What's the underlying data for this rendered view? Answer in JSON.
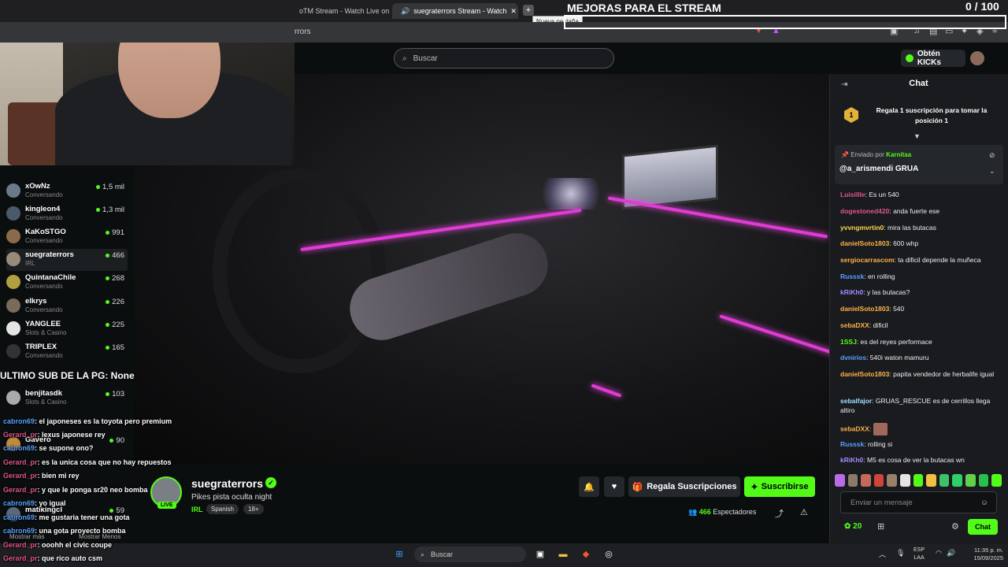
{
  "browser": {
    "tabs": [
      {
        "label": "oTM Stream - Watch Live on Ki"
      },
      {
        "label": "suegraterrors Stream - Watch"
      }
    ],
    "tooltip": "Nueva pestaña",
    "address": "rrors"
  },
  "overlay": {
    "title": "MEJORAS PARA EL STREAM",
    "counter": "0 / 100",
    "ultimo_sub": "ULTIMO SUB DE LA PG: None"
  },
  "header": {
    "search_placeholder": "Buscar",
    "kicks_label": "Obtén KICKs"
  },
  "sidebar": {
    "channels": [
      {
        "name": "xOwNz",
        "category": "Conversando",
        "viewers": "1,5 mil"
      },
      {
        "name": "kingleon4",
        "category": "Conversando",
        "viewers": "1,3 mil"
      },
      {
        "name": "KaKoSTGO",
        "category": "Conversando",
        "viewers": "991"
      },
      {
        "name": "suegraterrors",
        "category": "IRL",
        "viewers": "466"
      },
      {
        "name": "QuintanaChile",
        "category": "Conversando",
        "viewers": "268"
      },
      {
        "name": "elkrys",
        "category": "Conversando",
        "viewers": "226"
      },
      {
        "name": "YANGLEE",
        "category": "Slots & Casino",
        "viewers": "225"
      },
      {
        "name": "TRIPLEX",
        "category": "Conversando",
        "viewers": "165"
      },
      {
        "name": "benjitasdk",
        "category": "Slots & Casino",
        "viewers": "103"
      },
      {
        "name": "Gavero",
        "category": "",
        "viewers": "90"
      },
      {
        "name": "matikingcl",
        "category": "",
        "viewers": "59"
      }
    ],
    "show_more": "Mostrar más",
    "show_less": "Mostrar Menos"
  },
  "overlay_chat": [
    {
      "user": "cabron69",
      "text": "el japoneses es la toyota pero premium"
    },
    {
      "user": "Gerard_pr",
      "text": "lexus japonese rey"
    },
    {
      "user": "cabron69",
      "text": "se supone ono?"
    },
    {
      "user": "Gerard_pr",
      "text": "es la unica cosa que no hay repuestos"
    },
    {
      "user": "Gerard_pr",
      "text": "bien mi rey"
    },
    {
      "user": "Gerard_pr",
      "text": "y que le ponga sr20 neo bomba"
    },
    {
      "user": "cabron69",
      "text": "yo igual"
    },
    {
      "user": "cabron69",
      "text": "me gustaria tener una gota"
    },
    {
      "user": "cabron69",
      "text": "una gota proyecto bomba"
    },
    {
      "user": "Gerard_pr",
      "text": "ooohh el civic coupe"
    },
    {
      "user": "Gerard_pr",
      "text": "que rico auto csm"
    }
  ],
  "stream": {
    "streamer": "suegraterrors",
    "live_badge": "LIVE",
    "title": "Pikes pista oculta night",
    "category": "IRL",
    "tags": [
      "Spanish",
      "18+"
    ],
    "gift_label": "Regala Suscripciones",
    "subscribe_label": "Suscribirse",
    "viewers_count": "466",
    "viewers_label": "Espectadores"
  },
  "chat": {
    "title": "Chat",
    "gift_banner": "Regala 1 suscripción para tomar la posición 1",
    "gift_rank": "1",
    "pinned_by_label": "Enviado por",
    "pinned_by_user": "Karnitaa",
    "pinned_message": "@a_arismendi GRUA",
    "messages": [
      {
        "user": "Luisillle",
        "text": ": Es un 540",
        "color": "#e0568a"
      },
      {
        "user": "dogestoned420",
        "text": ": anda fuerte ese",
        "color": "#e0568a"
      },
      {
        "user": "yvvngmvrtin0",
        "text": ": mira las butacas",
        "color": "#ffd84d"
      },
      {
        "user": "danielSoto1803",
        "text": ": 600 whp",
        "color": "#ffb347"
      },
      {
        "user": "sergiocarrascom",
        "text": ": ta dificil depende la muñeca",
        "color": "#ffb347"
      },
      {
        "user": "Russsk",
        "text": ": en rolling",
        "color": "#5aa0ff"
      },
      {
        "user": "kRiKh0",
        "text": ": y las butacas?",
        "color": "#a58bff"
      },
      {
        "user": "danielSoto1803",
        "text": ": 540",
        "color": "#ffb347"
      },
      {
        "user": "sebaDXX",
        "text": ": dificil",
        "color": "#ffb347"
      },
      {
        "user": "1SSJ",
        "text": ": es del reyes performace",
        "color": "#53fc18"
      },
      {
        "user": "dvnirios",
        "text": ": 540i waton mamuru",
        "color": "#5aa0ff"
      },
      {
        "user": "danielSoto1803",
        "text": ": papita vendedor de herbalife igual",
        "color": "#ffb347"
      },
      {
        "user": "sebalfajor",
        "text": ": GRUAS_RESCUE es de cerrillos llega altiro",
        "color": "#9fe0ff"
      },
      {
        "user": "sebaDXX",
        "text": ":",
        "color": "#ffb347"
      },
      {
        "user": "Russsk",
        "text": ": rolling si",
        "color": "#5aa0ff"
      },
      {
        "user": "kRiKh0",
        "text": ": M5 es cosa de ver la butacas wn",
        "color": "#a58bff"
      }
    ],
    "input_placeholder": "Enviar un mensaje",
    "points": "20",
    "send_label": "Chat"
  },
  "taskbar": {
    "search_placeholder": "Buscar",
    "lang_line1": "ESP",
    "lang_line2": "LAA",
    "time": "11:35 p. m.",
    "date": "15/09/2025"
  },
  "colors": {
    "kick_green": "#53fc18",
    "neon_pink": "#e13bd6",
    "bg": "#0b0e0f"
  }
}
